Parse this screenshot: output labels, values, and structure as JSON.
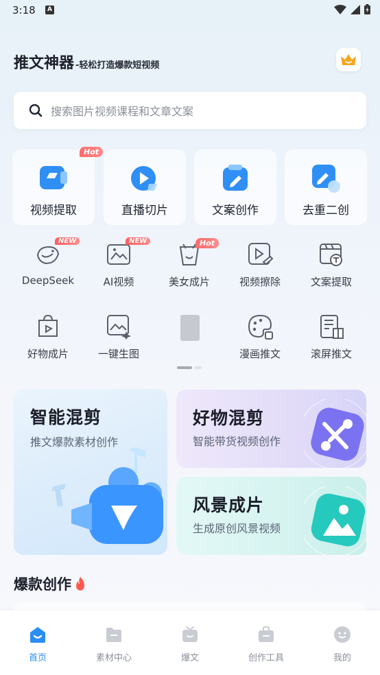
{
  "status": {
    "time": "3:18",
    "a_icon": "A"
  },
  "header": {
    "app_name": "推文神器",
    "slogan": "-轻松打造爆款短视频"
  },
  "search": {
    "placeholder": "搜索图片视频课程和文章文案"
  },
  "feature_tiles": [
    {
      "label": "视频提取",
      "badge": "Hot",
      "icon": "video-extract-icon"
    },
    {
      "label": "直播切片",
      "icon": "live-clip-icon"
    },
    {
      "label": "文案创作",
      "icon": "copywriting-icon"
    },
    {
      "label": "去重二创",
      "icon": "dedupe-recreate-icon"
    }
  ],
  "tools_row1": [
    {
      "label": "DeepSeek",
      "badge": "NEW"
    },
    {
      "label": "AI视频",
      "badge": "NEW"
    },
    {
      "label": "美女成片",
      "badge": "Hot"
    },
    {
      "label": "视频擦除"
    },
    {
      "label": "文案提取"
    }
  ],
  "tools_row2": [
    {
      "label": "好物成片"
    },
    {
      "label": "一键生图"
    },
    {
      "label": ""
    },
    {
      "label": "漫画推文"
    },
    {
      "label": "滚屏推文"
    }
  ],
  "cards": {
    "smart_mix": {
      "title": "智能混剪",
      "subtitle": "推文爆款素材创作"
    },
    "goods_mix": {
      "title": "好物混剪",
      "subtitle": "智能带货视频创作"
    },
    "scenery": {
      "title": "风景成片",
      "subtitle": "生成原创风景视频"
    }
  },
  "section": {
    "title": "爆款创作"
  },
  "tabs": [
    {
      "label": "首页",
      "active": true
    },
    {
      "label": "素材中心"
    },
    {
      "label": "爆文"
    },
    {
      "label": "创作工具"
    },
    {
      "label": "我的"
    }
  ],
  "colors": {
    "accent": "#2b8ef0",
    "hot": "#ff6a6a",
    "crown": "#f7a51c"
  }
}
